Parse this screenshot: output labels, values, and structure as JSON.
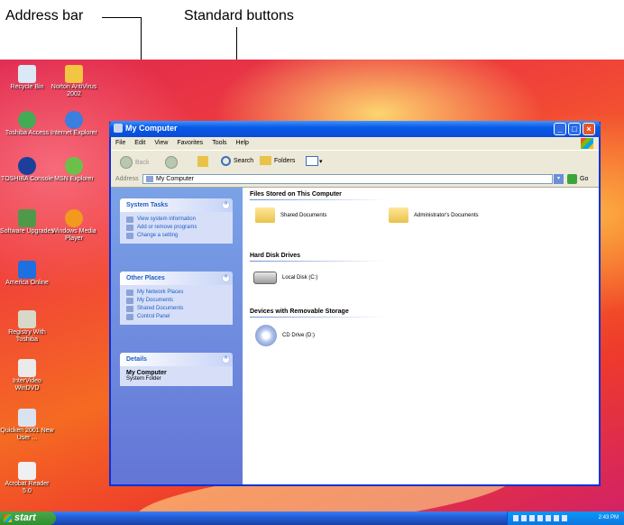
{
  "callouts": {
    "address_bar": "Address bar",
    "standard_buttons": "Standard buttons"
  },
  "desktop_icons": [
    {
      "label": "Recycle Bin"
    },
    {
      "label": "Norton AntiVirus 2002"
    },
    {
      "label": "Toshiba Access"
    },
    {
      "label": "Internet Explorer"
    },
    {
      "label": "TOSHIBA Console"
    },
    {
      "label": "MSN Explorer"
    },
    {
      "label": "Software Upgrades"
    },
    {
      "label": "Windows Media Player"
    },
    {
      "label": "America Online"
    },
    {
      "label": "Registry With Toshiba"
    },
    {
      "label": "InterVideo WinDVD"
    },
    {
      "label": "Quicken 2001 New User ..."
    },
    {
      "label": "Acrobat Reader 5.0"
    }
  ],
  "window": {
    "title": "My Computer",
    "menu": [
      "File",
      "Edit",
      "View",
      "Favorites",
      "Tools",
      "Help"
    ],
    "toolbar": {
      "back": "Back",
      "search": "Search",
      "folders": "Folders"
    },
    "address": {
      "label": "Address",
      "value": "My Computer",
      "go": "Go"
    },
    "system_tasks": {
      "title": "System Tasks",
      "items": [
        "View system information",
        "Add or remove programs",
        "Change a setting"
      ]
    },
    "other_places": {
      "title": "Other Places",
      "items": [
        "My Network Places",
        "My Documents",
        "Shared Documents",
        "Control Panel"
      ]
    },
    "details": {
      "title": "Details",
      "name": "My Computer",
      "type": "System Folder"
    },
    "sections": {
      "files": {
        "title": "Files Stored on This Computer",
        "items": [
          "Shared Documents",
          "Administrator's Documents"
        ]
      },
      "drives": {
        "title": "Hard Disk Drives",
        "items": [
          "Local Disk (C:)"
        ]
      },
      "removable": {
        "title": "Devices with Removable Storage",
        "items": [
          "CD Drive (D:)"
        ]
      }
    }
  },
  "taskbar": {
    "start": "start",
    "clock": "2:43 PM"
  }
}
